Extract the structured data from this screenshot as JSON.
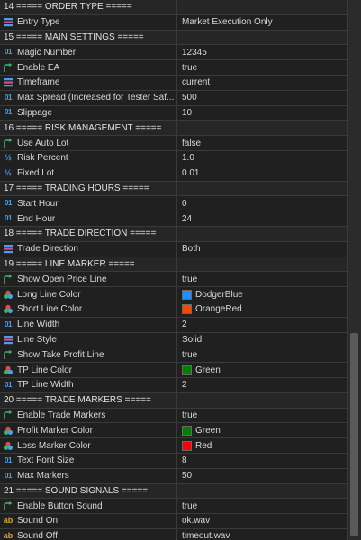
{
  "rows": [
    {
      "kind": "group",
      "name": "14 ===== ORDER TYPE ====="
    },
    {
      "kind": "prop",
      "icon": "enum",
      "name": "Entry Type",
      "value": "Market Execution Only"
    },
    {
      "kind": "group",
      "name": "15 ===== MAIN SETTINGS ====="
    },
    {
      "kind": "prop",
      "icon": "int",
      "name": "Magic Number",
      "value": "12345"
    },
    {
      "kind": "prop",
      "icon": "bool",
      "name": "Enable EA",
      "value": "true"
    },
    {
      "kind": "prop",
      "icon": "enum",
      "name": "Timeframe",
      "value": "current"
    },
    {
      "kind": "prop",
      "icon": "int",
      "name": "Max Spread (Increased for Tester Saf...",
      "value": "500"
    },
    {
      "kind": "prop",
      "icon": "int",
      "name": "Slippage",
      "value": "10"
    },
    {
      "kind": "group",
      "name": "16 ===== RISK MANAGEMENT ====="
    },
    {
      "kind": "prop",
      "icon": "bool",
      "name": "Use Auto Lot",
      "value": "false"
    },
    {
      "kind": "prop",
      "icon": "double",
      "name": "Risk Percent",
      "value": "1.0"
    },
    {
      "kind": "prop",
      "icon": "double",
      "name": "Fixed Lot",
      "value": "0.01"
    },
    {
      "kind": "group",
      "name": "17 ===== TRADING HOURS ====="
    },
    {
      "kind": "prop",
      "icon": "int",
      "name": "Start Hour",
      "value": "0"
    },
    {
      "kind": "prop",
      "icon": "int",
      "name": "End Hour",
      "value": "24"
    },
    {
      "kind": "group",
      "name": "18 ===== TRADE DIRECTION ====="
    },
    {
      "kind": "prop",
      "icon": "enum",
      "name": "Trade Direction",
      "value": "Both"
    },
    {
      "kind": "group",
      "name": "19 ===== LINE MARKER ====="
    },
    {
      "kind": "prop",
      "icon": "bool",
      "name": "Show Open Price Line",
      "value": "true"
    },
    {
      "kind": "prop",
      "icon": "color",
      "name": "Long Line Color",
      "value": "DodgerBlue",
      "swatch": "#1e90ff"
    },
    {
      "kind": "prop",
      "icon": "color",
      "name": "Short Line Color",
      "value": "OrangeRed",
      "swatch": "#ff4500"
    },
    {
      "kind": "prop",
      "icon": "int",
      "name": "Line Width",
      "value": "2"
    },
    {
      "kind": "prop",
      "icon": "enum",
      "name": "Line Style",
      "value": "Solid"
    },
    {
      "kind": "prop",
      "icon": "bool",
      "name": "Show Take Profit Line",
      "value": "true"
    },
    {
      "kind": "prop",
      "icon": "color",
      "name": "TP Line Color",
      "value": "Green",
      "swatch": "#008000"
    },
    {
      "kind": "prop",
      "icon": "int",
      "name": "TP Line Width",
      "value": "2"
    },
    {
      "kind": "group",
      "name": "20 ===== TRADE MARKERS ====="
    },
    {
      "kind": "prop",
      "icon": "bool",
      "name": "Enable Trade Markers",
      "value": "true"
    },
    {
      "kind": "prop",
      "icon": "color",
      "name": "Profit Marker Color",
      "value": "Green",
      "swatch": "#008000"
    },
    {
      "kind": "prop",
      "icon": "color",
      "name": "Loss Marker Color",
      "value": "Red",
      "swatch": "#ff0000"
    },
    {
      "kind": "prop",
      "icon": "int",
      "name": "Text Font Size",
      "value": "8"
    },
    {
      "kind": "prop",
      "icon": "int",
      "name": "Max Markers",
      "value": "50"
    },
    {
      "kind": "group",
      "name": "21 ===== SOUND SIGNALS ====="
    },
    {
      "kind": "prop",
      "icon": "bool",
      "name": "Enable Button Sound",
      "value": "true"
    },
    {
      "kind": "prop",
      "icon": "string",
      "name": "Sound On",
      "value": "ok.wav"
    },
    {
      "kind": "prop",
      "icon": "string",
      "name": "Sound Off",
      "value": "timeout.wav"
    }
  ],
  "icon_names": {
    "int": "integer-type-icon",
    "double": "double-type-icon",
    "bool": "boolean-type-icon",
    "enum": "enum-type-icon",
    "color": "color-type-icon",
    "string": "string-type-icon"
  },
  "colors": {
    "background": "#1e1e1e",
    "grid_line": "#3a3a3a",
    "type_icon_blue": "#4aa0e8",
    "bool_icon_green": "#3cb371",
    "string_icon_orange": "#e0a030"
  }
}
